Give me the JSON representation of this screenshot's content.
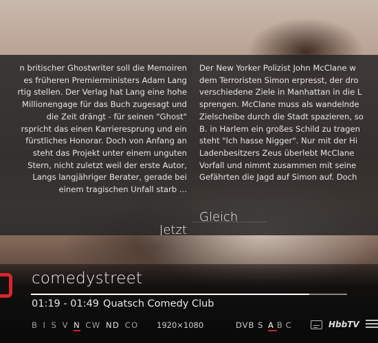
{
  "now_panel": {
    "label": "Jetzt",
    "description_lines": [
      "n britischer Ghostwriter soll die Memoiren",
      "es früheren Premierministers Adam Lang",
      "rtig stellen. Der Verlag hat Lang eine hohe",
      "Millionengage für das Buch zugesagt und",
      "die Zeit drängt - für seinen \"Ghost\"",
      "rspricht das einen Karrieresprung und ein",
      "fürstliches Honorar. Doch von Anfang an",
      "steht das Projekt unter einem unguten",
      "Stern, nicht zuletzt weil der erste Autor,",
      "Langs langjähriger Berater, gerade bei",
      "einem tragischen Unfall starb ..."
    ]
  },
  "next_panel": {
    "label": "Gleich",
    "description_lines": [
      "Der New Yorker Polizist John McClane w",
      "dem Terroristen Simon erpresst, der dro",
      "verschiedene Ziele in Manhattan in die L",
      "sprengen. McClane muss als wandelnde",
      "Zielscheibe durch die Stadt spazieren, so",
      "B. in Harlem ein großes Schild zu tragen",
      "steht \"Ich hasse Nigger\". Nur mit der Hi",
      "Ladenbesitzers Zeus überlebt McClane",
      "Vorfall und nimmt zusammen mit seine",
      "Gefährten die Jagd auf Simon auf. Doch"
    ]
  },
  "channel": {
    "name": "comedystreet",
    "time": "01:19 - 01:49",
    "programme_title": "Quatsch Comedy Club",
    "progress": 0.88
  },
  "badges": [
    {
      "text": "B",
      "highlight": false
    },
    {
      "text": "I",
      "highlight": false
    },
    {
      "text": "S",
      "highlight": false
    },
    {
      "text": "V",
      "highlight": false
    },
    {
      "text": "N",
      "highlight": true,
      "underline": true
    },
    {
      "text": "CW",
      "highlight": false
    },
    {
      "text": "ND",
      "highlight": true
    },
    {
      "text": "CO",
      "highlight": false
    }
  ],
  "resolution": "1920×1080",
  "tuner": "DVB S",
  "audio_tracks": [
    "A",
    "B",
    "C"
  ],
  "audio_selected": "A",
  "hbbtv_label": "HbbTV",
  "icons": {
    "subtitles": "subtitles-icon",
    "menu": "menu-icon"
  },
  "colors": {
    "accent": "#d8262b"
  }
}
